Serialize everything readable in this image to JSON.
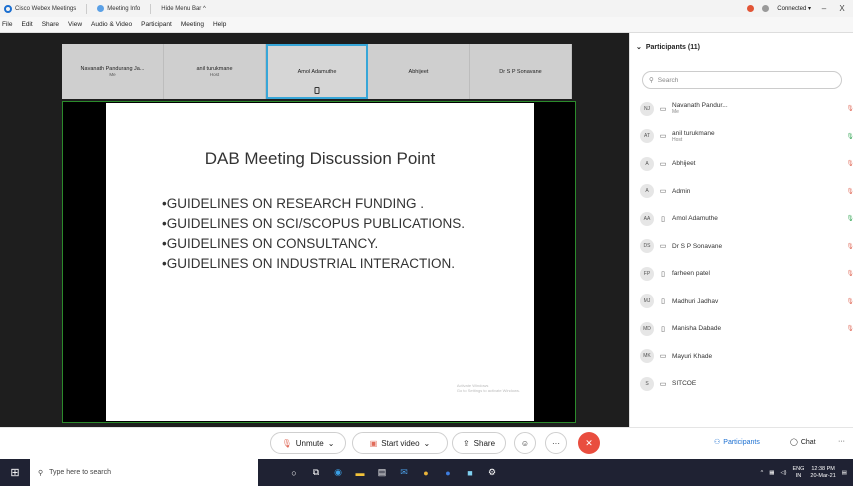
{
  "titlebar": {
    "app_name": "Cisco Webex Meetings",
    "meeting_info": "Meeting Info",
    "hide_menu": "Hide Menu Bar ^",
    "status": "Connected ▾",
    "minimize": "–",
    "close": "X"
  },
  "menu": {
    "items": [
      "File",
      "Edit",
      "Share",
      "View",
      "Audio & Video",
      "Participant",
      "Meeting",
      "Help"
    ]
  },
  "thumbnails": [
    {
      "name": "Navanath Pandurang Ja...",
      "role": "Me"
    },
    {
      "name": "anil turukmane",
      "role": "Host"
    },
    {
      "name": "Amol Adamuthe",
      "role": ""
    },
    {
      "name": "Abhijeet",
      "role": ""
    },
    {
      "name": "Dr S P Sonavane",
      "role": ""
    }
  ],
  "slide": {
    "title": "DAB Meeting Discussion Point",
    "bullets": [
      "•GUIDELINES ON RESEARCH FUNDING .",
      "•GUIDELINES ON SCI/SCOPUS PUBLICATIONS.",
      "•GUIDELINES ON CONSULTANCY.",
      "•GUIDELINES ON INDUSTRIAL INTERACTION."
    ],
    "watermark_line1": "Activate Windows",
    "watermark_line2": "Go to Settings to activate Windows."
  },
  "controls": {
    "unmute": "Unmute",
    "start_video": "Start video",
    "share": "Share",
    "participants": "Participants",
    "chat": "Chat"
  },
  "panel": {
    "title": "Participants (11)",
    "search_placeholder": "Search",
    "participants": [
      {
        "initials": "NJ",
        "name": "Navanath Pandur...",
        "role": "Me",
        "device": "computer",
        "muted": true
      },
      {
        "initials": "AT",
        "name": "anil turukmane",
        "role": "Host",
        "device": "computer",
        "muted": false
      },
      {
        "initials": "A",
        "name": "Abhijeet",
        "role": "",
        "device": "computer",
        "muted": true
      },
      {
        "initials": "A",
        "name": "Admin",
        "role": "",
        "device": "computer",
        "muted": true
      },
      {
        "initials": "AA",
        "name": "Amol Adamuthe",
        "role": "",
        "device": "phone",
        "muted": false
      },
      {
        "initials": "DS",
        "name": "Dr S P Sonavane",
        "role": "",
        "device": "computer",
        "muted": true
      },
      {
        "initials": "FP",
        "name": "farheen patel",
        "role": "",
        "device": "phone",
        "muted": true
      },
      {
        "initials": "MJ",
        "name": "Madhuri Jadhav",
        "role": "",
        "device": "phone",
        "muted": true
      },
      {
        "initials": "MD",
        "name": "Manisha Dabade",
        "role": "",
        "device": "phone",
        "muted": true
      },
      {
        "initials": "MK",
        "name": "Mayuri Khade",
        "role": "",
        "device": "computer",
        "muted": true
      },
      {
        "initials": "S",
        "name": "SITCOE",
        "role": "",
        "device": "computer",
        "muted": false
      }
    ]
  },
  "taskbar": {
    "search_placeholder": "Type here to search",
    "lang": "ENG",
    "region": "IN",
    "time": "12:38 PM",
    "date": "20-Mar-21"
  }
}
